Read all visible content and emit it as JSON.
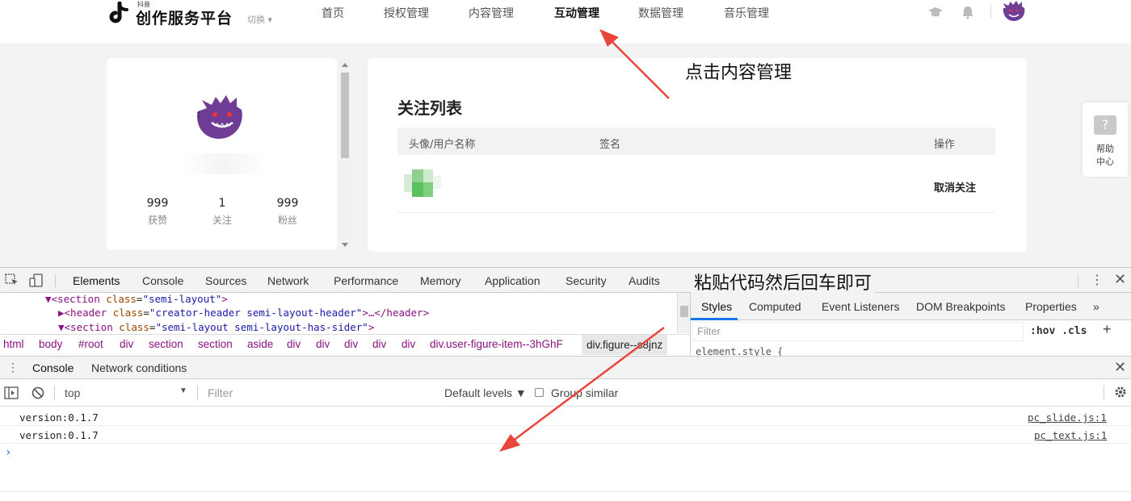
{
  "header": {
    "logo_small": "抖音",
    "logo_title": "创作服务平台",
    "switch_label": "切换 ▾",
    "nav": [
      {
        "label": "首页",
        "active": false
      },
      {
        "label": "授权管理",
        "active": false
      },
      {
        "label": "内容管理",
        "active": false
      },
      {
        "label": "互动管理",
        "active": true
      },
      {
        "label": "数据管理",
        "active": false
      },
      {
        "label": "音乐管理",
        "active": false
      }
    ],
    "icons": [
      "graduation-cap-icon",
      "bell-icon",
      "avatar"
    ]
  },
  "profile": {
    "stats": [
      {
        "value": "999",
        "label": "获赞"
      },
      {
        "value": "1",
        "label": "关注"
      },
      {
        "value": "999",
        "label": "粉丝"
      }
    ]
  },
  "follow_list": {
    "title": "关注列表",
    "columns": [
      "头像/用户名称",
      "签名",
      "操作"
    ],
    "rows": [
      {
        "action": "取消关注"
      }
    ]
  },
  "help": {
    "icon": "?",
    "line1": "帮助",
    "line2": "中心"
  },
  "annotations": {
    "top": "点击内容管理",
    "middle": "粘贴代码然后回车即可"
  },
  "devtools": {
    "tabs": [
      "Elements",
      "Console",
      "Sources",
      "Network",
      "Performance",
      "Memory",
      "Application",
      "Security",
      "Audits"
    ],
    "active_tab": "Elements",
    "dom": [
      {
        "tag_open": "▼<section ",
        "attr": "class",
        "value": "\"semi-layout\"",
        "tail": ">"
      },
      {
        "tag_open": "▶<header ",
        "attr": "class",
        "value": "\"creator-header semi-layout-header\"",
        "tail": ">…</header>"
      },
      {
        "tag_open": "▼<section ",
        "attr": "class",
        "value": "\"semi-layout semi-layout-has-sider\"",
        "tail": ">"
      }
    ],
    "breadcrumbs": [
      "html",
      "body",
      "#root",
      "div",
      "section",
      "section",
      "aside",
      "div",
      "div",
      "div",
      "div",
      "div",
      "div.user-figure-item--3hGhF",
      "div.figure--s8jnz"
    ],
    "styles_tabs": [
      "Styles",
      "Computed",
      "Event Listeners",
      "DOM Breakpoints",
      "Properties",
      "»"
    ],
    "styles_filter_placeholder": "Filter",
    "hov_cls": ":hov  .cls",
    "element_style": "element.style {",
    "drawer_tabs": [
      "Console",
      "Network conditions"
    ],
    "console_context": "top",
    "console_filter_placeholder": "Filter",
    "default_levels": "Default levels ▼",
    "group_similar": "Group similar",
    "logs": [
      {
        "message": "version:0.1.7",
        "source": "pc_slide.js:1"
      },
      {
        "message": "version:0.1.7",
        "source": "pc_text.js:1"
      }
    ],
    "prompt": "›"
  },
  "colors": {
    "page_bg": "#f3f3f3",
    "arrow": "#e8453c",
    "devtools_bg": "#f3f3f3",
    "devtools_tab_underline": "#1a73e8",
    "console_prompt": "#2a6cd3"
  }
}
